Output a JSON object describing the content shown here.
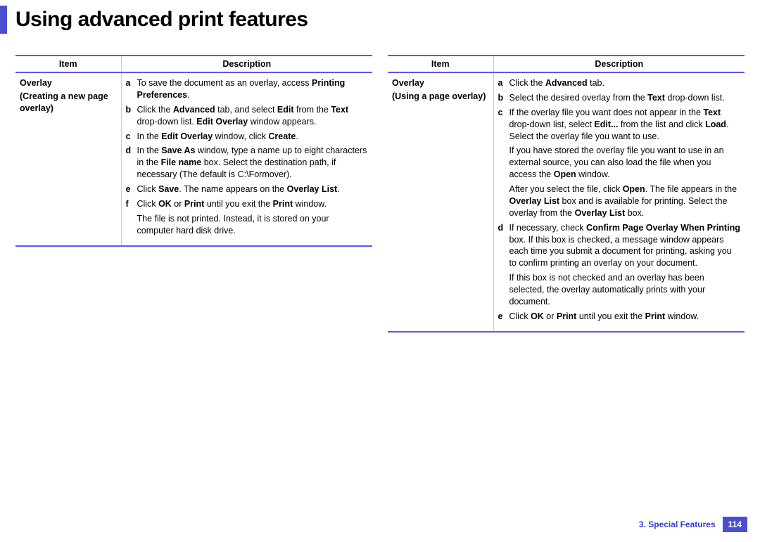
{
  "page_title": "Using advanced print features",
  "footer": {
    "section": "3.  Special Features",
    "page": "114"
  },
  "headers": {
    "item": "Item",
    "desc": "Description"
  },
  "left": {
    "item_title": "Overlay",
    "item_sub": "(Creating a new page overlay)",
    "steps": [
      {
        "letter": "a",
        "paras": [
          "To save the document as an overlay, access <b>Printing Preferences</b>."
        ]
      },
      {
        "letter": "b",
        "paras": [
          "Click the <b>Advanced</b> tab, and select <b>Edit</b> from the <b>Text</b> drop-down list. <b>Edit Overlay</b> window appears."
        ]
      },
      {
        "letter": "c",
        "paras": [
          "In the <b>Edit Overlay</b> window, click <b>Create</b>."
        ]
      },
      {
        "letter": "d",
        "paras": [
          "In the <b>Save As</b> window, type a name up to eight characters in the <b>File name</b> box. Select the destination path, if necessary (The default is C:\\Formover)."
        ]
      },
      {
        "letter": "e",
        "paras": [
          "Click <b>Save</b>. The name appears on the <b>Overlay List</b>."
        ]
      },
      {
        "letter": "f",
        "paras": [
          "Click <b>OK</b> or <b>Print</b> until you exit the <b>Print</b> window.",
          "The file is not printed. Instead, it is stored on your computer hard disk drive."
        ]
      }
    ]
  },
  "right": {
    "item_title": "Overlay",
    "item_sub": "(Using a page overlay)",
    "steps": [
      {
        "letter": "a",
        "paras": [
          "Click the <b>Advanced</b> tab."
        ]
      },
      {
        "letter": "b",
        "paras": [
          "Select the desired overlay from the <b>Text</b> drop-down list."
        ]
      },
      {
        "letter": "c",
        "paras": [
          "If the overlay file you want does not appear in the <b>Text</b> drop-down list, select <b>Edit...</b> from the list and click <b>Load</b>. Select the overlay file you want to use.",
          "If you have stored the overlay file you want to use in an external source, you can also load the file when you access the <b>Open</b> window.",
          "After you select the file, click <b>Open</b>. The file appears in the <b>Overlay List</b> box and is available for printing. Select the overlay from the <b>Overlay List</b> box."
        ]
      },
      {
        "letter": "d",
        "paras": [
          "If necessary, check <b>Confirm Page Overlay When Printing</b> box. If this box is checked, a message window appears each time you submit a document for printing, asking you to confirm printing an overlay on your document.",
          "If this box is not checked and an overlay has been selected, the overlay automatically prints with your document."
        ]
      },
      {
        "letter": "e",
        "paras": [
          "Click <b>OK</b> or <b>Print</b> until you exit the <b>Print</b> window."
        ]
      }
    ]
  }
}
